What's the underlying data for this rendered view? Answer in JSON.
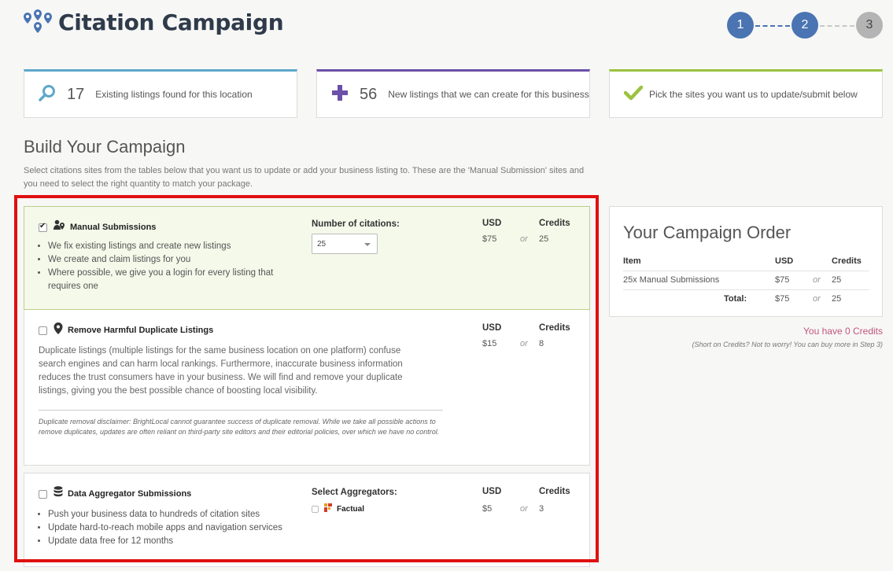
{
  "header": {
    "title": "Citation Campaign",
    "steps": [
      "1",
      "2",
      "3"
    ]
  },
  "info_cards": [
    {
      "icon": "search-icon",
      "count": "17",
      "text": "Existing listings found for this location",
      "accent": "#5fa7c9"
    },
    {
      "icon": "plus-icon",
      "count": "56",
      "text": "New listings that we can create for this business",
      "accent": "#6b4fa8"
    },
    {
      "icon": "check-icon",
      "count": "",
      "text": "Pick the sites you want us to update/submit below",
      "accent": "#9bc23e"
    }
  ],
  "build": {
    "title": "Build Your Campaign",
    "description": "Select citations sites from the tables below that you want us to update or add your business listing to. These are the 'Manual Submission' sites and you need to select the right quantity to match your package."
  },
  "packages": {
    "manual": {
      "title": "Manual Submissions",
      "checked": true,
      "bullets": [
        "We fix existing listings and create new listings",
        "We create and claim listings for you",
        "Where possible, we give you a login for every listing that requires one"
      ],
      "citations_label": "Number of citations:",
      "citations_value": "25",
      "usd_label": "USD",
      "credits_label": "Credits",
      "usd": "$75",
      "or": "or",
      "credits": "25"
    },
    "duplicates": {
      "title": "Remove Harmful Duplicate Listings",
      "checked": false,
      "paragraph": "Duplicate listings (multiple listings for the same business location on one platform) confuse search engines and can harm local rankings. Furthermore, inaccurate business information reduces the trust consumers have in your business. We will find and remove your duplicate listings, giving you the best possible chance of boosting local visibility.",
      "disclaimer": "Duplicate removal disclaimer: BrightLocal cannot guarantee success of duplicate removal. While we take all possible actions to remove duplicates, updates are often reliant on third-party site editors and their editorial policies, over which we have no control.",
      "usd_label": "USD",
      "credits_label": "Credits",
      "usd": "$15",
      "or": "or",
      "credits": "8"
    },
    "aggregator": {
      "title": "Data Aggregator Submissions",
      "checked": false,
      "bullets": [
        "Push your business data to hundreds of citation sites",
        "Update hard-to-reach mobile apps and navigation services",
        "Update data free for 12 months"
      ],
      "aggregators_label": "Select Aggregators:",
      "aggregator_name": "Factual",
      "usd_label": "USD",
      "credits_label": "Credits",
      "usd": "$5",
      "or": "or",
      "credits": "3"
    }
  },
  "order": {
    "title": "Your Campaign Order",
    "headers": {
      "item": "Item",
      "usd": "USD",
      "credits": "Credits"
    },
    "row": {
      "item": "25x Manual Submissions",
      "usd": "$75",
      "or": "or",
      "credits": "25"
    },
    "total": {
      "label": "Total:",
      "usd": "$75",
      "or": "or",
      "credits": "25"
    }
  },
  "credits": {
    "balance": "You have 0 Credits",
    "note": "(Short on Credits? Not to worry! You can buy more in Step 3)"
  },
  "colors": {
    "step_active": "#4a74b2",
    "step_inactive": "#b4b4b4",
    "highlight_frame": "#e01010",
    "credits_text": "#c0577d"
  }
}
